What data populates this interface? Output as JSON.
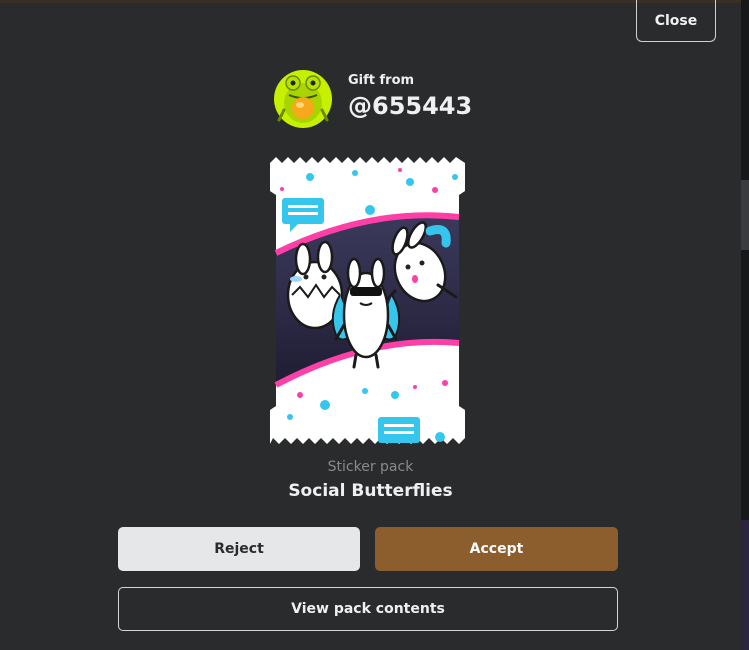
{
  "dialog": {
    "close_label": "Close",
    "gift_from_label": "Gift from",
    "sender_username": "@655443",
    "pack_type": "Sticker pack",
    "pack_name": "Social Butterflies",
    "reject_label": "Reject",
    "accept_label": "Accept",
    "view_contents_label": "View pack contents"
  },
  "colors": {
    "modal_bg": "#2a2b2d",
    "accept": "#8d5e2d",
    "reject": "#e6e7e9",
    "pack_pink": "#ff3fa8",
    "pack_cyan": "#35c6ee"
  },
  "icons": {
    "avatar": "frog-avatar-icon",
    "pack_art": "bunny-butterfly-stickers"
  }
}
